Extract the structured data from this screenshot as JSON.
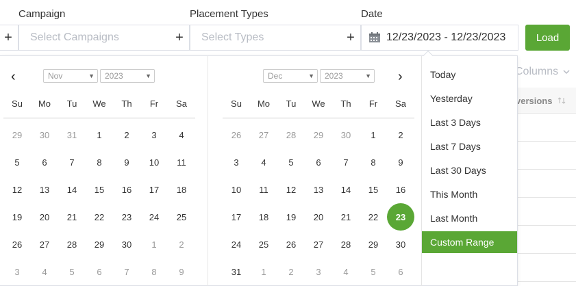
{
  "filters": {
    "campaign_label": "Campaign",
    "campaign_placeholder": "Select Campaigns",
    "placement_label": "Placement Types",
    "placement_placeholder": "Select Types",
    "date_label": "Date",
    "date_value": "12/23/2023 - 12/23/2023",
    "plus": "+",
    "load_label": "Load"
  },
  "table": {
    "columns_label": "Columns",
    "header_fragment": "versions"
  },
  "picker": {
    "prev_arrow": "‹",
    "next_arrow": "›",
    "weekdays": [
      "Su",
      "Mo",
      "Tu",
      "We",
      "Th",
      "Fr",
      "Sa"
    ],
    "left": {
      "month": "Nov",
      "year": "2023",
      "days": [
        [
          "29",
          "30",
          "31",
          "1",
          "2",
          "3",
          "4"
        ],
        [
          "5",
          "6",
          "7",
          "8",
          "9",
          "10",
          "11"
        ],
        [
          "12",
          "13",
          "14",
          "15",
          "16",
          "17",
          "18"
        ],
        [
          "19",
          "20",
          "21",
          "22",
          "23",
          "24",
          "25"
        ],
        [
          "26",
          "27",
          "28",
          "29",
          "30",
          "1",
          "2"
        ],
        [
          "3",
          "4",
          "5",
          "6",
          "7",
          "8",
          "9"
        ]
      ],
      "off": [
        [
          0,
          0
        ],
        [
          0,
          1
        ],
        [
          0,
          2
        ],
        [
          4,
          5
        ],
        [
          4,
          6
        ],
        [
          5,
          0
        ],
        [
          5,
          1
        ],
        [
          5,
          2
        ],
        [
          5,
          3
        ],
        [
          5,
          4
        ],
        [
          5,
          5
        ],
        [
          5,
          6
        ]
      ]
    },
    "right": {
      "month": "Dec",
      "year": "2023",
      "days": [
        [
          "26",
          "27",
          "28",
          "29",
          "30",
          "1",
          "2"
        ],
        [
          "3",
          "4",
          "5",
          "6",
          "7",
          "8",
          "9"
        ],
        [
          "10",
          "11",
          "12",
          "13",
          "14",
          "15",
          "16"
        ],
        [
          "17",
          "18",
          "19",
          "20",
          "21",
          "22",
          "23"
        ],
        [
          "24",
          "25",
          "26",
          "27",
          "28",
          "29",
          "30"
        ],
        [
          "31",
          "1",
          "2",
          "3",
          "4",
          "5",
          "6"
        ]
      ],
      "off": [
        [
          0,
          0
        ],
        [
          0,
          1
        ],
        [
          0,
          2
        ],
        [
          0,
          3
        ],
        [
          0,
          4
        ],
        [
          5,
          1
        ],
        [
          5,
          2
        ],
        [
          5,
          3
        ],
        [
          5,
          4
        ],
        [
          5,
          5
        ],
        [
          5,
          6
        ]
      ],
      "selected": [
        3,
        6
      ]
    },
    "ranges": [
      "Today",
      "Yesterday",
      "Last 3 Days",
      "Last 7 Days",
      "Last 30 Days",
      "This Month",
      "Last Month",
      "Custom Range"
    ],
    "active_range": "Custom Range"
  },
  "colors": {
    "accent": "#5aa735",
    "border": "#dcdfe6",
    "placeholder": "#b8bcc4"
  },
  "icons": [
    "plus-icon",
    "calendar-icon",
    "chevron-left-icon",
    "chevron-right-icon",
    "chevron-down-icon",
    "sort-icon"
  ]
}
